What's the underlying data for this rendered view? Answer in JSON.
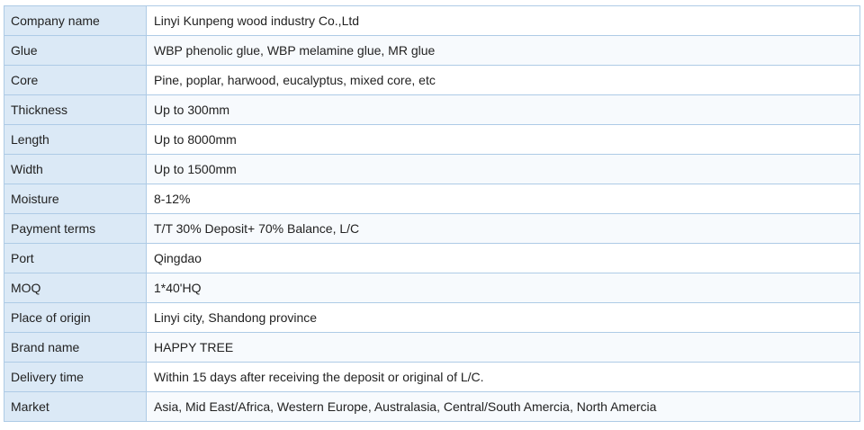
{
  "table": {
    "rows": [
      {
        "label": "Company name",
        "value": "Linyi Kunpeng wood industry Co.,Ltd"
      },
      {
        "label": "Glue",
        "value": "WBP phenolic glue, WBP melamine glue, MR glue"
      },
      {
        "label": "Core",
        "value": "Pine, poplar, harwood, eucalyptus, mixed core, etc"
      },
      {
        "label": "Thickness",
        "value": "Up to 300mm"
      },
      {
        "label": "Length",
        "value": "Up to 8000mm"
      },
      {
        "label": "Width",
        "value": "Up to 1500mm"
      },
      {
        "label": "Moisture",
        "value": "8-12%"
      },
      {
        "label": "Payment terms",
        "value": "T/T 30% Deposit+ 70% Balance, L/C"
      },
      {
        "label": "Port",
        "value": "Qingdao"
      },
      {
        "label": "MOQ",
        "value": "1*40'HQ"
      },
      {
        "label": "Place of origin",
        "value": "Linyi city, Shandong province"
      },
      {
        "label": "Brand name",
        "value": "HAPPY TREE"
      },
      {
        "label": "Delivery time",
        "value": "Within 15 days after receiving the deposit or original of L/C."
      },
      {
        "label": "Market",
        "value": "Asia, Mid East/Africa, Western Europe, Australasia, Central/South Amercia, North Amercia"
      }
    ]
  }
}
